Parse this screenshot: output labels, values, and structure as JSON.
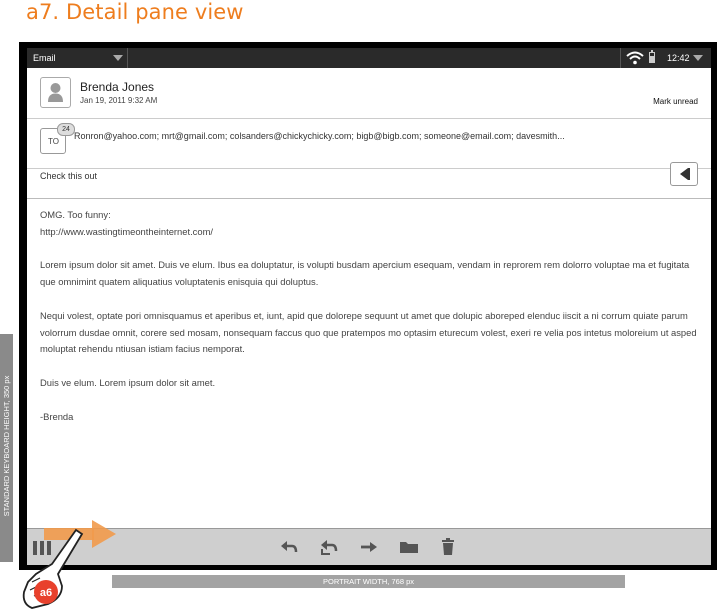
{
  "page_title": "a7. Detail pane view",
  "status_bar": {
    "app_label": "Email",
    "time": "12:42",
    "icons": [
      "wifi-icon",
      "battery-icon",
      "chevron-down-icon"
    ]
  },
  "sender": {
    "name": "Brenda Jones",
    "date": "Jan 19, 2011  9:32 AM",
    "avatar_icon": "person-icon"
  },
  "actions": {
    "mark_unread": "Mark unread"
  },
  "recipients": {
    "label": "TO",
    "count": "24",
    "text": "Ronron@yahoo.com; mrt@gmail.com; colsanders@chickychicky.com; bigb@bigb.com; someone@email.com; davesmith..."
  },
  "subject": "Check this out",
  "body": {
    "lines": [
      "OMG. Too funny:",
      "http://www.wastingtimeontheinternet.com/"
    ],
    "paragraphs": [
      "Lorem ipsum dolor sit amet. Duis ve elum. Ibus ea doluptatur, is volupti busdam apercium esequam, vendam in reprorem rem dolorro voluptae ma et fugitata que omnimint quatem aliquatius voluptatenis enisquia qui doluptus.",
      "Nequi volest, optate pori omnisquamus et aperibus et, iunt, apid que dolorepe sequunt ut amet que dolupic aboreped elenduc iiscit a ni corrum quiate parum volorrum dusdae omnit, corere sed mosam, nonsequam faccus quo que pratempos mo optasim eturecum volest, exeri re velia pos intetus moloreium ut asped moluptat rehendu ntiusan istiam facius nemporat.",
      "Duis ve elum. Lorem ipsum dolor sit amet.",
      "-Brenda"
    ]
  },
  "toolbar": {
    "icons": [
      "reply-icon",
      "reply-all-icon",
      "forward-icon",
      "folder-icon",
      "trash-icon"
    ]
  },
  "annotations": {
    "badge": "a6",
    "keyboard_height": "STANDARD KEYBOARD HEIGHT, 350 px",
    "portrait_width": "PORTRAIT WIDTH, 768 px"
  },
  "colors": {
    "heading_orange": "#ee7d1e",
    "badge_red": "#e8412c",
    "toolbar_gray": "#cfcfcf"
  }
}
